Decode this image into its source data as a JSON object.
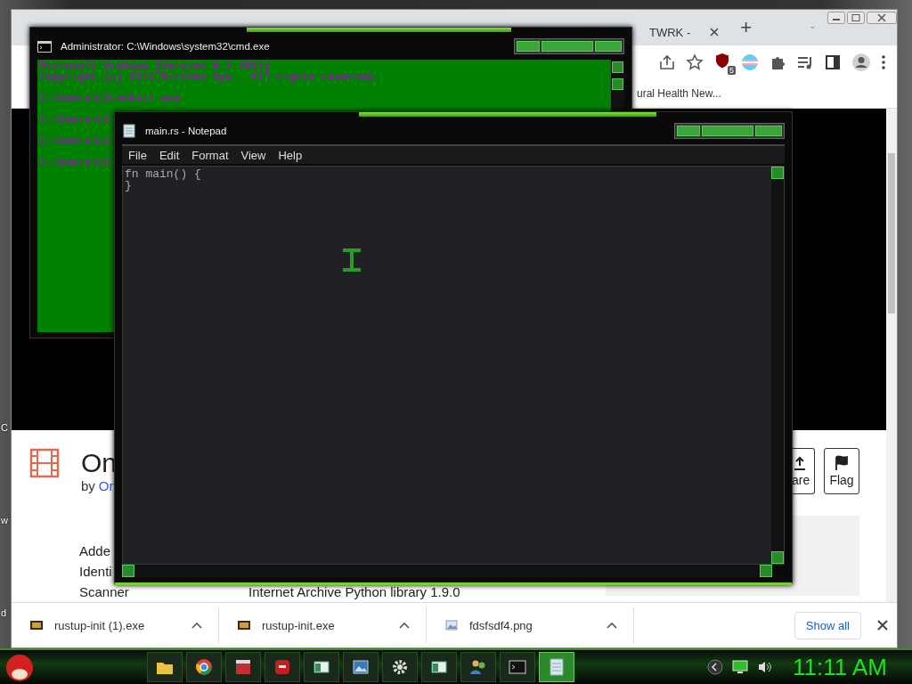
{
  "desktop": {
    "labels": [
      "C",
      "w",
      "d"
    ]
  },
  "browser": {
    "tabs": [
      {
        "label": "TWRK -",
        "selected": false
      }
    ],
    "new_tab": "+",
    "extension_badge": "5",
    "bookmark": "ural Health New...",
    "page": {
      "title": "On",
      "byline_prefix": "by",
      "byline_link": "On",
      "fields": [
        {
          "label": "Adde"
        },
        {
          "label": "Identi"
        },
        {
          "label": "Scanner",
          "value": "Internet Archive Python library 1.9.0"
        }
      ],
      "buttons": [
        {
          "kind": "share",
          "label": "are"
        },
        {
          "kind": "flag",
          "label": "Flag"
        }
      ]
    },
    "downloads": {
      "items": [
        {
          "kind": "exe",
          "name": "rustup-init (1).exe"
        },
        {
          "kind": "exe",
          "name": "rustup-init.exe"
        },
        {
          "kind": "image",
          "name": "fdsfsdf4.png"
        }
      ],
      "show_all": "Show all"
    }
  },
  "cmd": {
    "title": "Administrator: C:\\Windows\\system32\\cmd.exe",
    "lines": [
      {
        "text": "Microsoft Windows [Version 6.1.7601]",
        "blank_before": false
      },
      {
        "text": "Copyright (c) 2012 Dilchad Sys.  All rights reserved.",
        "blank_before": false
      },
      {
        "text": "C:\\Users\\LOL>mkdir ass",
        "blank_before": true
      },
      {
        "text": "C:\\Users\\LO",
        "blank_before": true
      },
      {
        "text": "C:\\Users\\LO",
        "blank_before": true
      },
      {
        "text": "C:\\Users\\LO",
        "blank_before": true
      }
    ]
  },
  "notepad": {
    "title": "main.rs - Notepad",
    "menu": [
      "File",
      "Edit",
      "Format",
      "View",
      "Help"
    ],
    "lines": [
      "fn main() {",
      "}"
    ]
  },
  "taskbar": {
    "apps": [
      {
        "kind": "folder",
        "selected": false
      },
      {
        "kind": "browser",
        "selected": false
      },
      {
        "kind": "toolbox",
        "selected": false
      },
      {
        "kind": "devtool",
        "selected": false
      },
      {
        "kind": "window",
        "selected": false
      },
      {
        "kind": "picture",
        "selected": false
      },
      {
        "kind": "gear",
        "selected": false
      },
      {
        "kind": "window",
        "selected": false
      },
      {
        "kind": "users",
        "selected": false
      },
      {
        "kind": "terminal",
        "selected": false
      },
      {
        "kind": "notepad",
        "selected": true
      }
    ],
    "clock": "11:11 AM"
  }
}
